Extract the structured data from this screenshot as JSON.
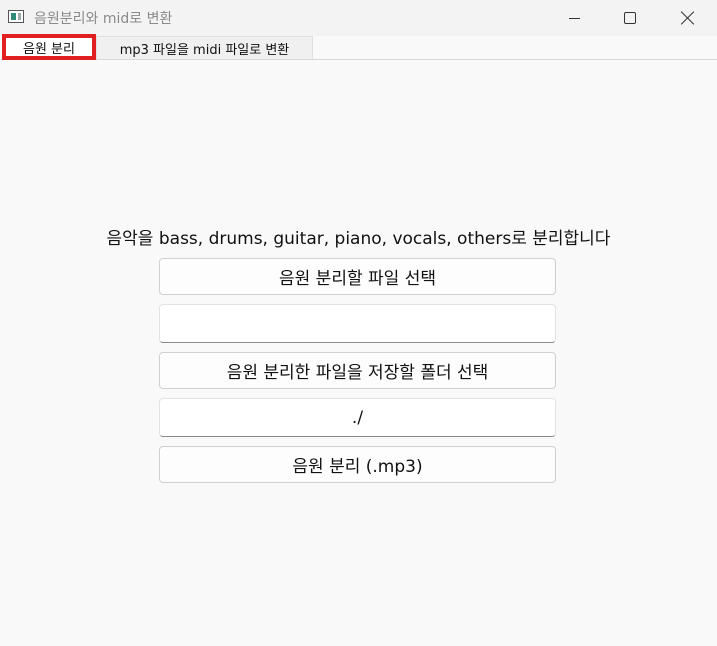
{
  "window": {
    "title": "음원분리와 mid로 변환",
    "icon": "app-window-icon"
  },
  "titlebar_buttons": {
    "minimize": "minimize-icon",
    "maximize": "maximize-icon",
    "close": "close-icon"
  },
  "tabs": [
    {
      "label": "음원 분리",
      "selected": true
    },
    {
      "label": "mp3 파일을 midi 파일로 변환",
      "selected": false
    }
  ],
  "main": {
    "heading": "음악을 bass, drums, guitar, piano, vocals, others로 분리합니다",
    "select_file_button": "음원 분리할 파일 선택",
    "file_path_value": "",
    "select_folder_button": "음원 분리한 파일을 저장할 폴더 선택",
    "folder_path_value": "./",
    "separate_button": "음원 분리 (.mp3)"
  },
  "colors": {
    "highlight_border": "#e02020",
    "background": "#f9f9f9"
  }
}
